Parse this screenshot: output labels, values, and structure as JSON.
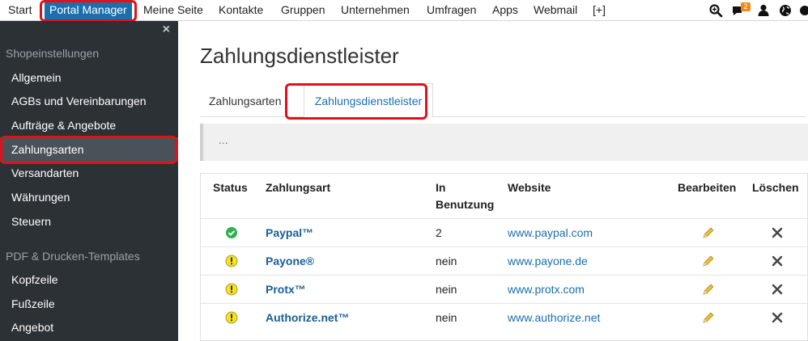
{
  "topnav": {
    "items": [
      {
        "label": "Start"
      },
      {
        "label": "Portal Manager"
      },
      {
        "label": "Meine Seite"
      },
      {
        "label": "Kontakte"
      },
      {
        "label": "Gruppen"
      },
      {
        "label": "Unternehmen"
      },
      {
        "label": "Umfragen"
      },
      {
        "label": "Apps"
      },
      {
        "label": "Webmail"
      },
      {
        "label": "[+]"
      }
    ],
    "notification_count": "2",
    "icons": [
      "search-icon",
      "chat-icon",
      "user-icon",
      "globe-icon",
      "gear-icon"
    ],
    "accent_color": "#1a6fad",
    "highlight_color": "#e3101b"
  },
  "sidebar": {
    "close_symbol": "×",
    "section1": "Shopeinstellungen",
    "items1": [
      {
        "label": "Allgemein"
      },
      {
        "label": "AGBs und Vereinbarungen"
      },
      {
        "label": "Aufträge & Angebote"
      },
      {
        "label": "Zahlungsarten"
      },
      {
        "label": "Versandarten"
      },
      {
        "label": "Währungen"
      },
      {
        "label": "Steuern"
      }
    ],
    "section2": "PDF & Drucken-Templates",
    "items2": [
      {
        "label": "Kopfzeile"
      },
      {
        "label": "Fußzeile"
      },
      {
        "label": "Angebot"
      }
    ]
  },
  "main": {
    "title": "Zahlungsdienstleister",
    "tabs": [
      {
        "label": "Zahlungsarten"
      },
      {
        "label": "Zahlungsdienstleister"
      }
    ],
    "info_text": "...",
    "table": {
      "headers": {
        "status": "Status",
        "name": "Zahlungsart",
        "usage_line1": "In",
        "usage_line2": "Benutzung",
        "website": "Website",
        "edit": "Bearbeiten",
        "delete": "Löschen"
      },
      "rows": [
        {
          "status": "ok",
          "name": "Paypal™",
          "usage": "2",
          "website": "www.paypal.com"
        },
        {
          "status": "warning",
          "name": "Payone®",
          "usage": "nein",
          "website": "www.payone.de"
        },
        {
          "status": "warning",
          "name": "Protx™",
          "usage": "nein",
          "website": "www.protx.com"
        },
        {
          "status": "warning",
          "name": "Authorize.net™",
          "usage": "nein",
          "website": "www.authorize.net"
        }
      ]
    }
  }
}
